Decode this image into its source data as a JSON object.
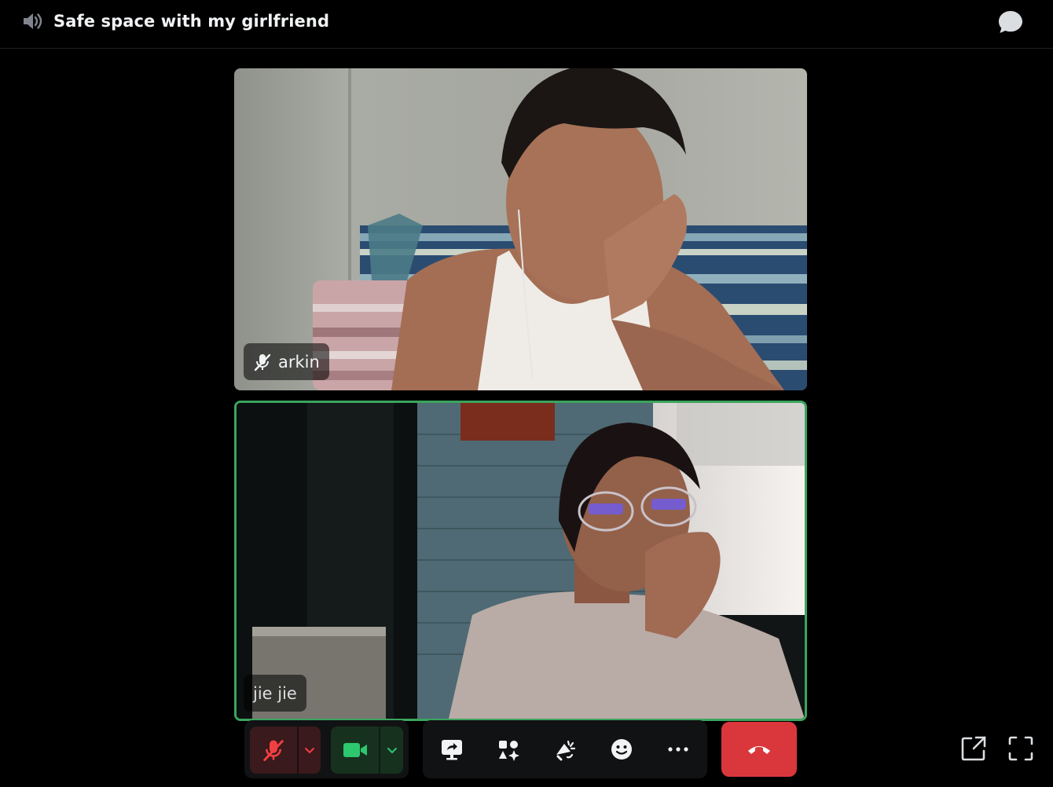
{
  "header": {
    "channel_name": "Safe space with my girlfriend",
    "speaker_icon": "speaker-icon",
    "chat_icon": "chat-bubble-icon"
  },
  "participants": [
    {
      "name": "arkin",
      "muted": true,
      "speaking": false,
      "video": "webcam-video"
    },
    {
      "name": "jie jie",
      "muted": false,
      "speaking": true,
      "video": "webcam-video"
    }
  ],
  "controls": {
    "microphone": {
      "icon": "microphone-muted-icon",
      "state": "muted"
    },
    "camera": {
      "icon": "camera-icon",
      "state": "on"
    },
    "tools": [
      {
        "id": "share",
        "icon": "screen-share-icon"
      },
      {
        "id": "activities",
        "icon": "activities-icon"
      },
      {
        "id": "soundboard",
        "icon": "soundboard-icon"
      },
      {
        "id": "emoji",
        "icon": "emoji-icon"
      },
      {
        "id": "more",
        "icon": "more-icon"
      }
    ],
    "hangup": {
      "icon": "phone-hangup-icon"
    }
  },
  "corner": {
    "popout_icon": "popout-icon",
    "fullscreen_icon": "fullscreen-icon"
  },
  "colors": {
    "background": "#000000",
    "speaking_ring": "#3ba55d",
    "hangup": "#da373c",
    "muted_red": "#f23f43",
    "camera_green": "#2dc770"
  }
}
